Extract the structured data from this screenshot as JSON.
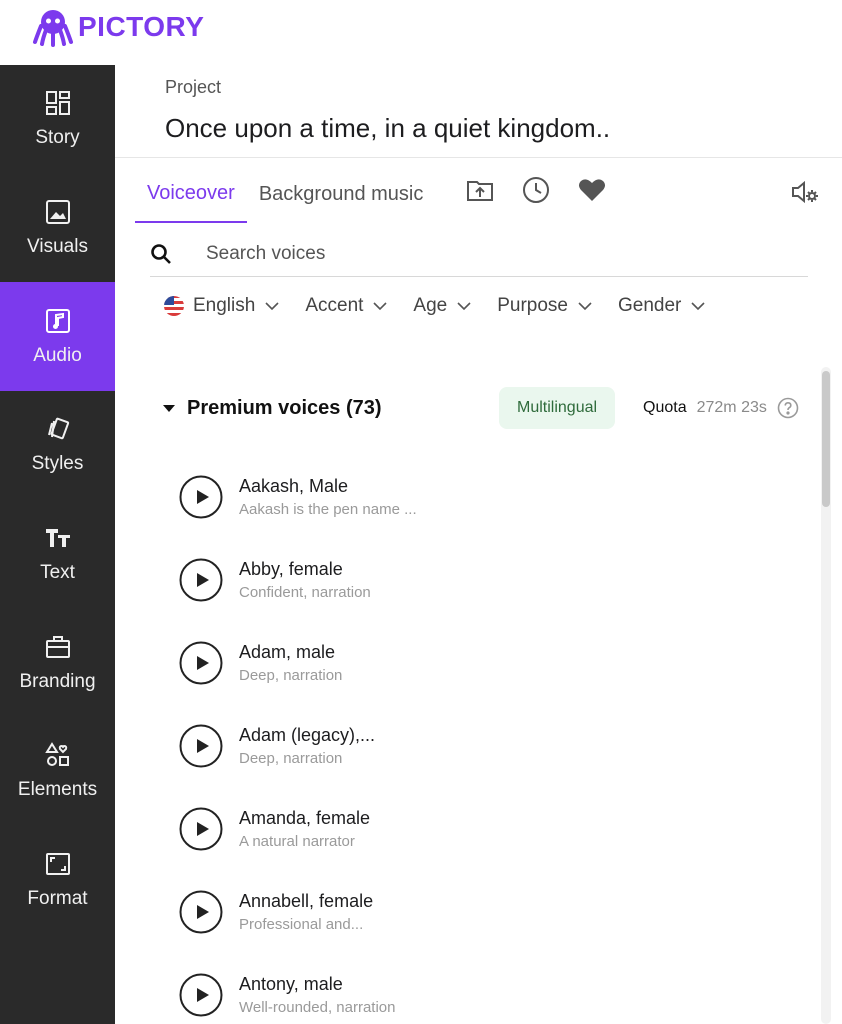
{
  "brand": {
    "name": "PICTORY",
    "color": "#7c3aed"
  },
  "sidebar": {
    "items": [
      {
        "label": "Story",
        "icon": "story-icon"
      },
      {
        "label": "Visuals",
        "icon": "image-icon"
      },
      {
        "label": "Audio",
        "icon": "music-note-icon",
        "active": true
      },
      {
        "label": "Styles",
        "icon": "styles-icon"
      },
      {
        "label": "Text",
        "icon": "text-icon"
      },
      {
        "label": "Branding",
        "icon": "briefcase-icon"
      },
      {
        "label": "Elements",
        "icon": "shapes-icon"
      },
      {
        "label": "Format",
        "icon": "aspect-ratio-icon"
      }
    ]
  },
  "project": {
    "caption": "Project",
    "title": "Once upon a time, in a quiet kingdom.."
  },
  "tabs": [
    {
      "label": "Voiceover",
      "active": true
    },
    {
      "label": "Background music"
    }
  ],
  "tab_icons": [
    "upload-folder-icon",
    "history-clock-icon",
    "favorite-heart-icon",
    "voice-settings-icon"
  ],
  "search": {
    "placeholder": "Search voices",
    "value": ""
  },
  "filters": [
    {
      "label": "English",
      "flag": "us-flag-icon"
    },
    {
      "label": "Accent"
    },
    {
      "label": "Age"
    },
    {
      "label": "Purpose"
    },
    {
      "label": "Gender"
    }
  ],
  "section": {
    "title": "Premium voices (73)",
    "badge": "Multilingual",
    "quota_label": "Quota",
    "quota_value": "272m 23s"
  },
  "voices": [
    {
      "name": "Aakash, Male",
      "desc": "Aakash is the pen name ..."
    },
    {
      "name": "Abby, female",
      "desc": "Confident, narration"
    },
    {
      "name": "Adam, male",
      "desc": "Deep, narration"
    },
    {
      "name": "Adam (legacy),...",
      "desc": "Deep, narration"
    },
    {
      "name": "Amanda, female",
      "desc": "A natural narrator"
    },
    {
      "name": "Annabell, female",
      "desc": "Professional and..."
    },
    {
      "name": "Antony, male",
      "desc": "Well-rounded, narration"
    }
  ],
  "colors": {
    "accent": "#7c3aed",
    "sidebar_bg": "#2a2a2a",
    "badge_bg": "#eaf7ee"
  }
}
